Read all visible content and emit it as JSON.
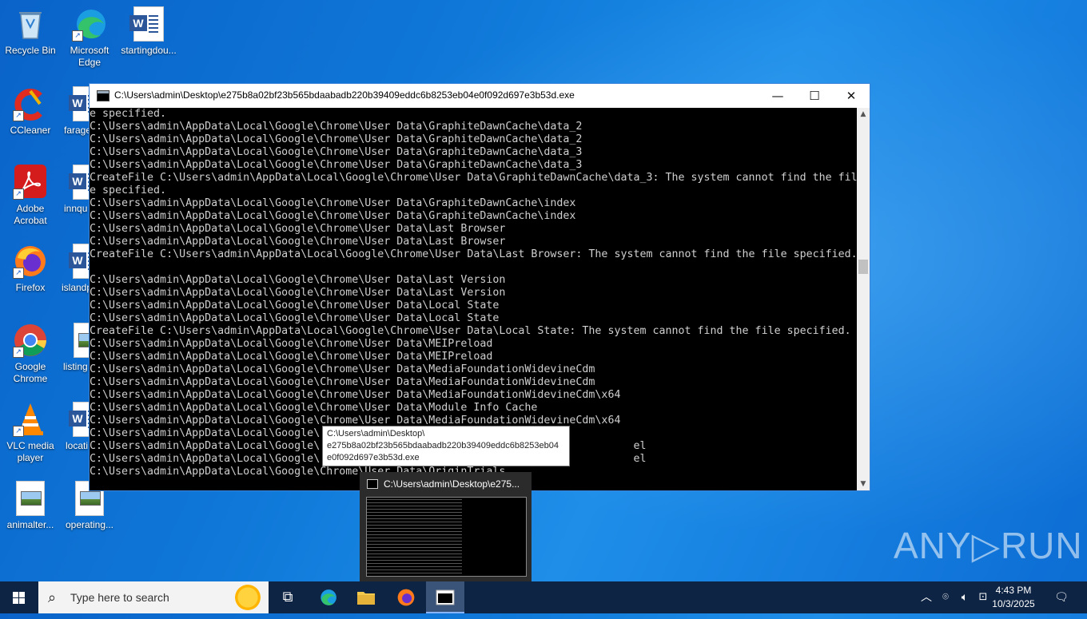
{
  "desktop": {
    "icons": [
      {
        "label": "Recycle Bin"
      },
      {
        "label": "Microsoft Edge"
      },
      {
        "label": "startingdou..."
      },
      {
        "label": "CCleaner"
      },
      {
        "label": "farage"
      },
      {
        "label": "Adobe Acrobat"
      },
      {
        "label": "innqu"
      },
      {
        "label": "Firefox"
      },
      {
        "label": "islandp"
      },
      {
        "label": "Google Chrome"
      },
      {
        "label": "listing"
      },
      {
        "label": "VLC media player"
      },
      {
        "label": "locati"
      },
      {
        "label": "animalter..."
      },
      {
        "label": "operating..."
      }
    ]
  },
  "console_window": {
    "title": "C:\\Users\\admin\\Desktop\\e275b8a02bf23b565bdaabadb220b39409eddc6b8253eb04e0f092d697e3b53d.exe",
    "minimize": "—",
    "maximize": "☐",
    "close": "✕",
    "lines": [
      "e specified.",
      "C:\\Users\\admin\\AppData\\Local\\Google\\Chrome\\User Data\\GraphiteDawnCache\\data_2",
      "C:\\Users\\admin\\AppData\\Local\\Google\\Chrome\\User Data\\GraphiteDawnCache\\data_2",
      "C:\\Users\\admin\\AppData\\Local\\Google\\Chrome\\User Data\\GraphiteDawnCache\\data_3",
      "C:\\Users\\admin\\AppData\\Local\\Google\\Chrome\\User Data\\GraphiteDawnCache\\data_3",
      "CreateFile C:\\Users\\admin\\AppData\\Local\\Google\\Chrome\\User Data\\GraphiteDawnCache\\data_3: The system cannot find the fil",
      "e specified.",
      "C:\\Users\\admin\\AppData\\Local\\Google\\Chrome\\User Data\\GraphiteDawnCache\\index",
      "C:\\Users\\admin\\AppData\\Local\\Google\\Chrome\\User Data\\GraphiteDawnCache\\index",
      "C:\\Users\\admin\\AppData\\Local\\Google\\Chrome\\User Data\\Last Browser",
      "C:\\Users\\admin\\AppData\\Local\\Google\\Chrome\\User Data\\Last Browser",
      "CreateFile C:\\Users\\admin\\AppData\\Local\\Google\\Chrome\\User Data\\Last Browser: The system cannot find the file specified.",
      "",
      "C:\\Users\\admin\\AppData\\Local\\Google\\Chrome\\User Data\\Last Version",
      "C:\\Users\\admin\\AppData\\Local\\Google\\Chrome\\User Data\\Last Version",
      "C:\\Users\\admin\\AppData\\Local\\Google\\Chrome\\User Data\\Local State",
      "C:\\Users\\admin\\AppData\\Local\\Google\\Chrome\\User Data\\Local State",
      "CreateFile C:\\Users\\admin\\AppData\\Local\\Google\\Chrome\\User Data\\Local State: The system cannot find the file specified.",
      "C:\\Users\\admin\\AppData\\Local\\Google\\Chrome\\User Data\\MEIPreload",
      "C:\\Users\\admin\\AppData\\Local\\Google\\Chrome\\User Data\\MEIPreload",
      "C:\\Users\\admin\\AppData\\Local\\Google\\Chrome\\User Data\\MediaFoundationWidevineCdm",
      "C:\\Users\\admin\\AppData\\Local\\Google\\Chrome\\User Data\\MediaFoundationWidevineCdm",
      "C:\\Users\\admin\\AppData\\Local\\Google\\Chrome\\User Data\\MediaFoundationWidevineCdm\\x64",
      "C:\\Users\\admin\\AppData\\Local\\Google\\Chrome\\User Data\\Module Info Cache",
      "C:\\Users\\admin\\AppData\\Local\\Google\\Chrome\\User Data\\MediaFoundationWidevineCdm\\x64",
      "C:\\Users\\admin\\AppData\\Local\\Google\\",
      "C:\\Users\\admin\\AppData\\Local\\Google\\                                                 el",
      "C:\\Users\\admin\\AppData\\Local\\Google\\                                                 el",
      "C:\\Users\\admin\\AppData\\Local\\Google\\Chrome\\User Data\\OriginTrials"
    ]
  },
  "tooltip": {
    "line1": "C:\\Users\\admin\\Desktop\\",
    "line2": "e275b8a02bf23b565bdaabadb220b39409eddc6b8253eb04",
    "line3": "e0f092d697e3b53d.exe"
  },
  "taskbar_preview": {
    "title": "C:\\Users\\admin\\Desktop\\e275..."
  },
  "watermark": "ANY▷RUN",
  "taskbar": {
    "search_placeholder": "Type here to search",
    "time": "4:43 PM",
    "date": "10/3/2025"
  }
}
